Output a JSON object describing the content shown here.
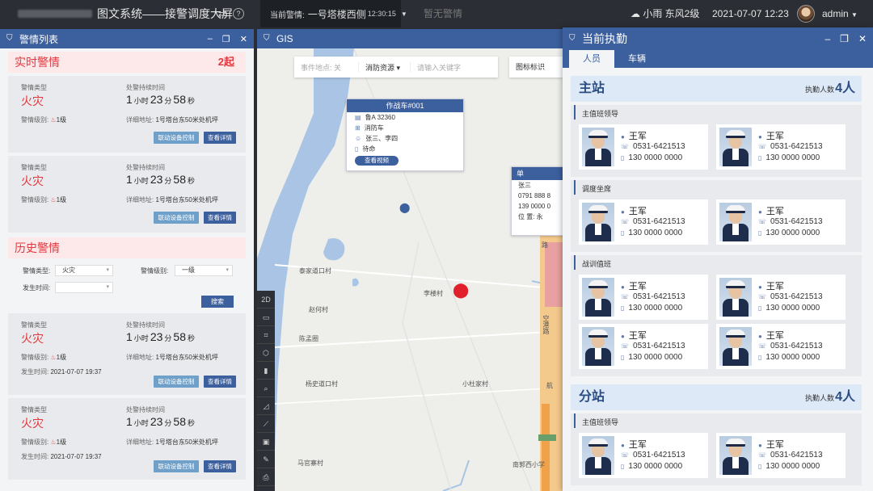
{
  "topbar": {
    "title": "图文系统——接警调度大屏",
    "current_alarm_label": "当前警情:",
    "current_alarm_value": "一号塔楼西侧",
    "current_alarm_time": "12:30:15",
    "no_alarm": "暂无警情",
    "weather": "小雨 东风2级",
    "datetime": "2021-07-07 12:23",
    "user": "admin"
  },
  "left_panel": {
    "title": "警情列表",
    "realtime_title": "实时警情",
    "realtime_count": "2起",
    "history_title": "历史警情",
    "labels": {
      "type": "警情类型",
      "duration": "处警持续时间",
      "level": "警情级别:",
      "address": "详细地址:",
      "time": "发生时间:",
      "btn_link": "联动设备控制",
      "btn_detail": "查看详情"
    },
    "realtime_cards": [
      {
        "type": "火灾",
        "h": "1",
        "m": "23",
        "s": "58",
        "level": "1级",
        "address": "1号塔台东50米处机坪"
      },
      {
        "type": "火灾",
        "h": "1",
        "m": "23",
        "s": "58",
        "level": "1级",
        "address": "1号塔台东50米处机坪"
      }
    ],
    "history_cards": [
      {
        "type": "火灾",
        "h": "1",
        "m": "23",
        "s": "58",
        "level": "1级",
        "address": "1号塔台东50米处机坪",
        "time": "2021-07-07 19:37"
      },
      {
        "type": "火灾",
        "h": "1",
        "m": "23",
        "s": "58",
        "level": "1级",
        "address": "1号塔台东50米处机坪",
        "time": "2021-07-07 19:37"
      }
    ],
    "filter": {
      "type_label": "警情类型:",
      "type_value": "火灾",
      "level_label": "警情级别:",
      "level_value": "一级",
      "time_label": "发生时间:",
      "search": "搜索"
    },
    "units": {
      "h": "小时",
      "m": "分",
      "s": "秒"
    }
  },
  "map": {
    "title": "GIS",
    "search_location": "事件地点: 关",
    "resource": "消防资源 ▾",
    "keyword_placeholder": "请输入关键字",
    "legend": "图标标识",
    "popup": {
      "title": "作战车#001",
      "plate": "鲁A 32360",
      "vehicle_type": "消防车",
      "crew": "张三、李四",
      "status": "待命",
      "video_btn": "查看视频"
    },
    "popup2": {
      "title": "单",
      "name": "张三",
      "phone": "0791 888 8",
      "mobile": "139 0000 0",
      "position": "位 置: 永"
    },
    "labels": [
      "泰家道口村",
      "赵何村",
      "陈孟圈",
      "杨史道口村",
      "李楼村",
      "小杜家村",
      "马官寨村",
      "南郭西小学",
      "空港路",
      "航",
      "路"
    ],
    "tools": [
      "2D",
      "▭",
      "⌗",
      "⬡",
      "▮",
      "⌕",
      "◿",
      "⟋",
      "▣",
      "✎",
      "⎙",
      "⌂"
    ]
  },
  "right_panel": {
    "title": "当前执勤",
    "tabs": [
      "人员",
      "车辆"
    ],
    "duty_label": "执勤人数",
    "stations": [
      {
        "name": "主站",
        "count": "4人",
        "groups": [
          {
            "title": "主值班领导",
            "people": [
              {
                "name": "王军",
                "phone": "0531-6421513",
                "mobile": "130 0000 0000"
              },
              {
                "name": "王军",
                "phone": "0531-6421513",
                "mobile": "130 0000 0000"
              }
            ]
          },
          {
            "title": "调度坐席",
            "people": [
              {
                "name": "王军",
                "phone": "0531-6421513",
                "mobile": "130 0000 0000"
              },
              {
                "name": "王军",
                "phone": "0531-6421513",
                "mobile": "130 0000 0000"
              }
            ]
          },
          {
            "title": "战训值班",
            "people": [
              {
                "name": "王军",
                "phone": "0531-6421513",
                "mobile": "130 0000 0000"
              },
              {
                "name": "王军",
                "phone": "0531-6421513",
                "mobile": "130 0000 0000"
              },
              {
                "name": "王军",
                "phone": "0531-6421513",
                "mobile": "130 0000 0000"
              },
              {
                "name": "王军",
                "phone": "0531-6421513",
                "mobile": "130 0000 0000"
              }
            ]
          }
        ]
      },
      {
        "name": "分站",
        "count": "4人",
        "groups": [
          {
            "title": "主值班领导",
            "people": [
              {
                "name": "王军",
                "phone": "0531-6421513",
                "mobile": "130 0000 0000"
              },
              {
                "name": "王军",
                "phone": "0531-6421513",
                "mobile": "130 0000 0000"
              }
            ]
          }
        ]
      }
    ]
  },
  "colors": {
    "primary": "#3c5f9e",
    "alert": "#e0383e",
    "link_button": "#6fa0c9"
  }
}
